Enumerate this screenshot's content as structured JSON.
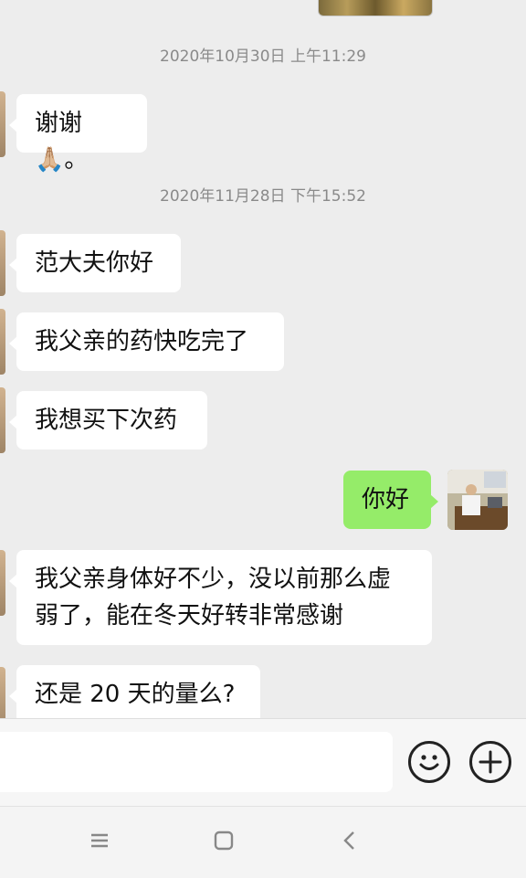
{
  "timestamps": {
    "first": "2020年10月30日 上午11:29",
    "second": "2020年11月28日 下午15:52"
  },
  "messages": [
    {
      "side": "left",
      "text": "谢谢🙏🏼。"
    },
    {
      "side": "left",
      "text": "范大夫你好"
    },
    {
      "side": "left",
      "text": "我父亲的药快吃完了"
    },
    {
      "side": "left",
      "text": "我想买下次药"
    },
    {
      "side": "right",
      "text": "你好"
    },
    {
      "side": "left",
      "text_line1": "我父亲身体好不少，没以前那么虚",
      "text_line2": "弱了，能在冬天好转非常感谢"
    },
    {
      "side": "left",
      "text": "还是 20 天的量么?"
    }
  ],
  "input_bar": {
    "emoji_icon": "emoji-smile-icon",
    "plus_icon": "plus-circle-icon"
  },
  "nav_bar": {
    "menu_icon": "menu-icon",
    "home_icon": "home-square-icon",
    "back_icon": "back-chevron-icon"
  },
  "colors": {
    "background": "#ededed",
    "bubble_left": "#ffffff",
    "bubble_right": "#95ec69",
    "timestamp_text": "#8a8a8a"
  }
}
